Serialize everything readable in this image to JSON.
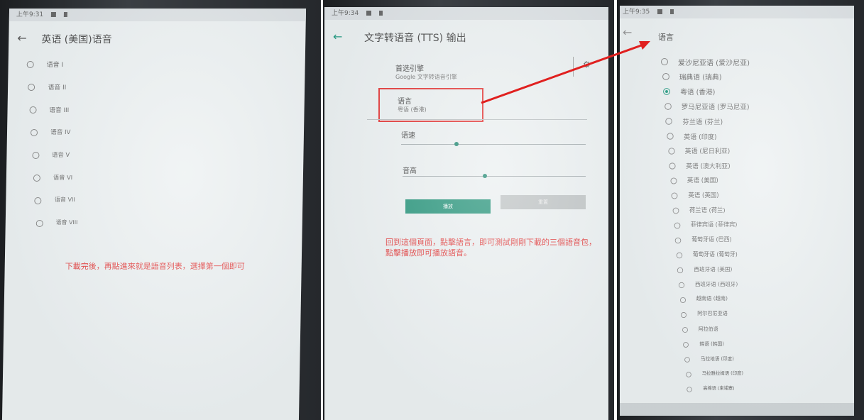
{
  "panel1": {
    "status_time": "上午9:31",
    "title": "英语 (美国)语音",
    "voices": [
      "语音 I",
      "语音 II",
      "语音 III",
      "语音 IV",
      "语音 V",
      "语音 VI",
      "语音 VII",
      "语音 VIII"
    ],
    "note": "下載完後，再點進來就是語音列表，選擇第一個即可"
  },
  "panel2": {
    "status_time": "上午9:34",
    "title": "文字转语音 (TTS) 输出",
    "engine_label": "首选引擎",
    "engine_value": "Google 文字转语音引擎",
    "language_label": "语言",
    "language_value": "粤语 (香港)",
    "rate_label": "语速",
    "pitch_label": "音高",
    "rate_value": 0.3,
    "pitch_value": 0.45,
    "play_label": "播放",
    "reset_label": "重置",
    "note_line1": "回到這個頁面，點擊語言，即可測試剛剛下載的三個語音包，",
    "note_line2": "點擊播放即可播放語音。"
  },
  "panel3": {
    "status_time": "上午9:35",
    "title": "语言",
    "selected_index": 2,
    "languages": [
      "爱沙尼亚语 (爱沙尼亚)",
      "瑞典语 (瑞典)",
      "粤语 (香港)",
      "罗马尼亚语 (罗马尼亚)",
      "芬兰语 (芬兰)",
      "英语 (印度)",
      "英语 (尼日利亚)",
      "英语 (澳大利亚)",
      "英语 (美国)",
      "英语 (英国)",
      "荷兰语 (荷兰)",
      "菲律宾语 (菲律宾)",
      "葡萄牙语 (巴西)",
      "葡萄牙语 (葡萄牙)",
      "西班牙语 (美国)",
      "西班牙语 (西班牙)",
      "越南语 (越南)",
      "阿尔巴尼亚语",
      "阿拉伯语",
      "韩语 (韩国)",
      "马拉地语 (印度)",
      "马拉雅拉姆语 (印度)",
      "高棉语 (柬埔寨)"
    ]
  },
  "colors": {
    "accent": "#0a8f73",
    "annotation": "#e02a2a",
    "button_disabled": "#b9bebf"
  }
}
